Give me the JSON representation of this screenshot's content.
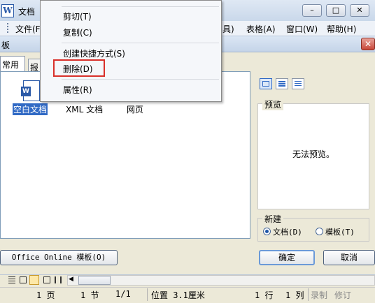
{
  "window": {
    "title": "文档",
    "minimize": "–",
    "maximize": "□",
    "close": "✕"
  },
  "menubar": {
    "file": "文件(F",
    "partial": "具)",
    "table": "表格(A)",
    "window": "窗口(W)",
    "help": "帮助(H)"
  },
  "dialog": {
    "title_fragment": "板",
    "close": "✕",
    "tabs": [
      "常用",
      "报"
    ],
    "items": [
      {
        "label": "空白文档",
        "icon": "word-document-icon"
      },
      {
        "label": "XML 文档",
        "icon": "xml-document-icon"
      },
      {
        "label": "网页",
        "icon": "web-page-icon"
      }
    ],
    "preview_label": "预览",
    "no_preview": "无法预览。",
    "new_label": "新建",
    "radio_document": "文档(D)",
    "radio_template": "模板(T)",
    "online_button": "Office Online 模板(O)",
    "ok_button": "确定",
    "cancel_button": "取消"
  },
  "context_menu": {
    "items": [
      "剪切(T)",
      "复制(C)",
      "创建快捷方式(S)",
      "删除(D)",
      "属性(R)"
    ],
    "highlighted": "删除(D)"
  },
  "status": {
    "page": "1 页",
    "section": "1 节",
    "page_of": "1/1",
    "position": "位置 3.1厘米",
    "line": "1 行",
    "col": "1 列",
    "record": "录制",
    "revise": "修订"
  },
  "colors": {
    "accent": "#316ac5",
    "highlight_box": "#d9302a"
  }
}
